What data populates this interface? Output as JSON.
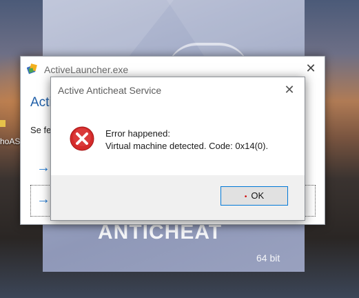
{
  "desktop": {
    "icon_label": "hoAS"
  },
  "splash": {
    "wordmark": "ANTICHEAT",
    "bits_label": "64 bit"
  },
  "launcher_window": {
    "title": "ActiveLauncher.exe",
    "heading": "Acti",
    "body_text": "Se fe",
    "close_glyph": "✕",
    "arrow_glyph": "→"
  },
  "dialog": {
    "title": "Active Anticheat Service",
    "close_glyph": "✕",
    "message_line1": "Error happened:",
    "message_line2": "Virtual machine detected. Code: 0x14(0).",
    "ok_label": "OK",
    "ok_marker": "•",
    "icon": "error-icon",
    "accent_color": "#0078d7",
    "error_color": "#d42a2a"
  }
}
